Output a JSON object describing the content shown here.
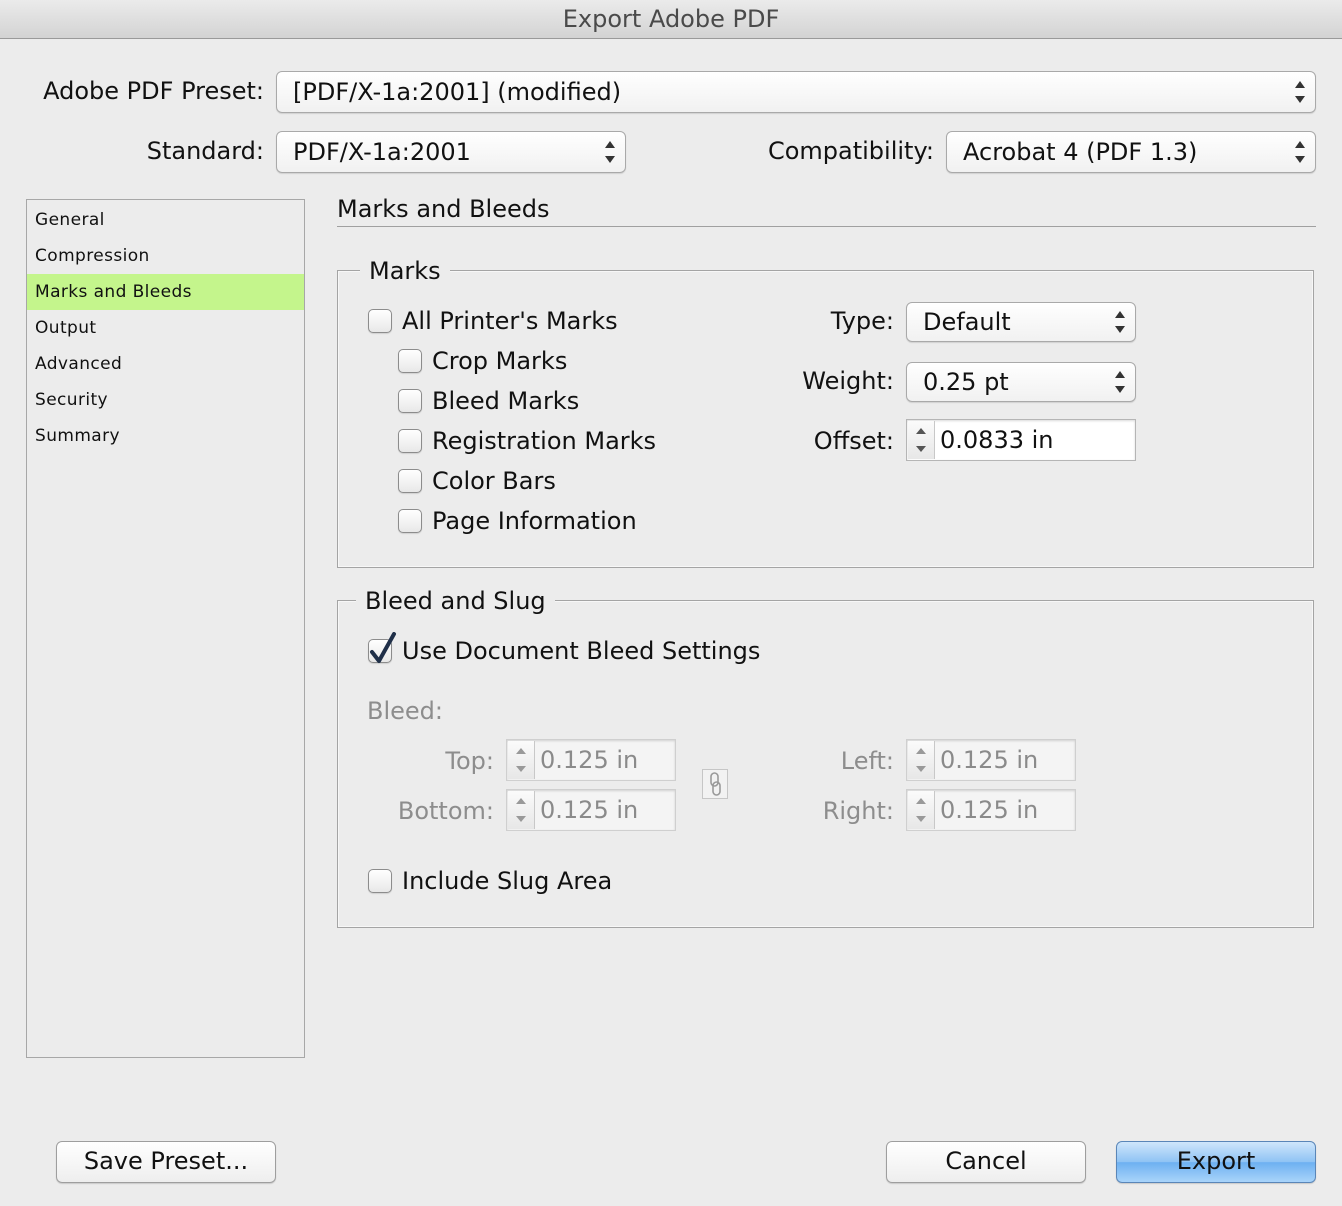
{
  "window": {
    "title": "Export Adobe PDF"
  },
  "preset": {
    "label": "Adobe PDF Preset:",
    "value": "[PDF/X-1a:2001] (modified)"
  },
  "standard": {
    "label": "Standard:",
    "value": "PDF/X-1a:2001"
  },
  "compatibility": {
    "label": "Compatibility:",
    "value": "Acrobat 4 (PDF 1.3)"
  },
  "sidebar": {
    "items": [
      {
        "label": "General"
      },
      {
        "label": "Compression"
      },
      {
        "label": "Marks and Bleeds",
        "selected": true
      },
      {
        "label": "Output"
      },
      {
        "label": "Advanced"
      },
      {
        "label": "Security"
      },
      {
        "label": "Summary"
      }
    ],
    "selected_color": "#c4f58c"
  },
  "page": {
    "title": "Marks and Bleeds"
  },
  "marks": {
    "legend": "Marks",
    "all_printers_marks": {
      "label": "All Printer's Marks",
      "checked": false
    },
    "crop_marks": {
      "label": "Crop Marks",
      "checked": false
    },
    "bleed_marks": {
      "label": "Bleed Marks",
      "checked": false
    },
    "registration_marks": {
      "label": "Registration Marks",
      "checked": false
    },
    "color_bars": {
      "label": "Color Bars",
      "checked": false
    },
    "page_information": {
      "label": "Page Information",
      "checked": false
    },
    "type": {
      "label": "Type:",
      "value": "Default"
    },
    "weight": {
      "label": "Weight:",
      "value": "0.25 pt"
    },
    "offset": {
      "label": "Offset:",
      "value": "0.0833 in"
    }
  },
  "bleed_slug": {
    "legend": "Bleed and Slug",
    "use_document_bleed": {
      "label": "Use Document Bleed Settings",
      "checked": true
    },
    "bleed_label": "Bleed:",
    "top": {
      "label": "Top:",
      "value": "0.125 in"
    },
    "bottom": {
      "label": "Bottom:",
      "value": "0.125 in"
    },
    "left": {
      "label": "Left:",
      "value": "0.125 in"
    },
    "right": {
      "label": "Right:",
      "value": "0.125 in"
    },
    "include_slug": {
      "label": "Include Slug Area",
      "checked": false
    }
  },
  "buttons": {
    "save_preset": "Save Preset...",
    "cancel": "Cancel",
    "export": "Export"
  },
  "icons": {
    "chain": "chain-link-icon",
    "checkmark": "checkmark-icon",
    "popup_arrows": "updown-arrows-icon",
    "stepper": "stepper-icon"
  }
}
